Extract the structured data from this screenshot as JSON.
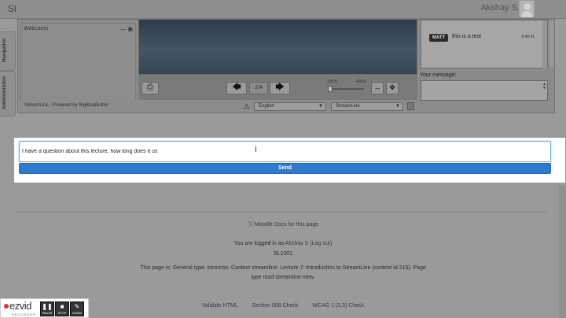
{
  "header": {
    "brand": "Sl",
    "user": "Akshay S"
  },
  "side_tabs": {
    "navigation": "Navigation",
    "administration": "Administration"
  },
  "streamline": {
    "webcam_title": "Webcams",
    "webcam_controls": "— ▣",
    "powered_by": "StreamLine - Powered by BigBlueButton",
    "page_indicator": "2/4",
    "zoom_min": "100%",
    "zoom_max": "400%",
    "zoom_level": 0.0,
    "language_select": "English",
    "stream_select": "StreamLine"
  },
  "chat": {
    "messages": [
      {
        "user": "MATT",
        "text": "this is a test",
        "time": "9:40:41"
      }
    ],
    "message_label": "Your message:"
  },
  "question": {
    "value": "I have a question about this lecture, how long does it us",
    "send_label": "Send"
  },
  "footer": {
    "docs_link": "Moodle Docs for this page",
    "logged_prefix": "You are logged in as ",
    "logged_user": "Akshay S",
    "logout": "(Log out)",
    "course": "SL1001",
    "page_info_line1": "This page is: General type: incourse. Context streamline: Lecture 7: Introduction to StreamLine (context id 215). Page",
    "page_info_line2": "type mod-streamline-view.",
    "validate_html": "Validate HTML",
    "section508": "Section 508 Check",
    "wcag": "WCAG 1 (2,3) Check"
  },
  "recorder": {
    "logo": "ezvid",
    "sub": "RECORDER",
    "pause": "PAUSE",
    "stop": "STOP",
    "draw": "DRAW"
  }
}
